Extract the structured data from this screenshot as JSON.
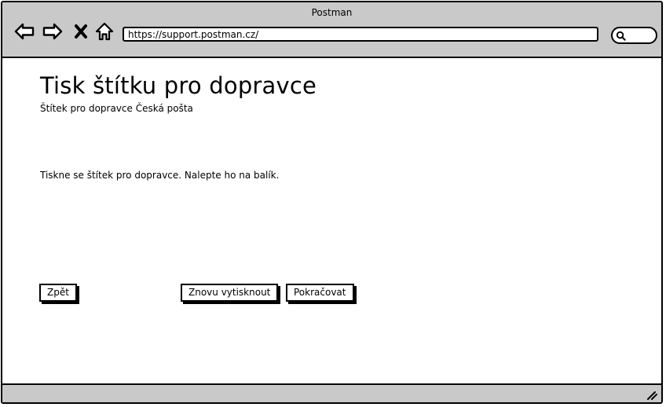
{
  "window": {
    "title": "Postman"
  },
  "toolbar": {
    "back_icon": "arrow-left-icon",
    "forward_icon": "arrow-right-icon",
    "close_icon": "close-icon",
    "home_icon": "home-icon",
    "url": "https://support.postman.cz/",
    "search_icon": "search-icon"
  },
  "page": {
    "title": "Tisk štítku pro dopravce",
    "subtitle": "Štítek pro dopravce Česká pošta",
    "message": "Tiskne se štítek pro dopravce. Nalepte ho na balík."
  },
  "buttons": {
    "back": "Zpět",
    "reprint": "Znovu vytisknout",
    "continue": "Pokračovat"
  },
  "statusbar": {
    "resize_icon": "resize-grip-icon"
  },
  "colors": {
    "chrome": "#c9c9c9",
    "border": "#000000",
    "background": "#ffffff"
  }
}
